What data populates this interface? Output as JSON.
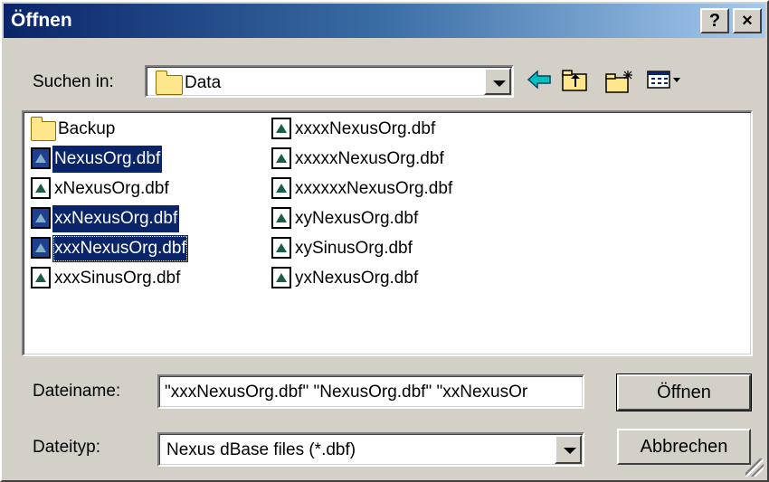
{
  "window": {
    "title": "Öffnen",
    "help_button": "?",
    "close_button": "×"
  },
  "lookin": {
    "label": "Suchen in:",
    "value": "Data",
    "icon": "folder-icon"
  },
  "toolbar": {
    "back_icon": "arrow-left-icon",
    "up_icon": "folder-up-icon",
    "new_folder_icon": "new-folder-icon",
    "view_menu_icon": "view-menu-icon"
  },
  "files": {
    "col1": [
      {
        "name": "Backup",
        "type": "folder",
        "selected": false
      },
      {
        "name": "NexusOrg.dbf",
        "type": "file",
        "selected": true
      },
      {
        "name": "xNexusOrg.dbf",
        "type": "file",
        "selected": false
      },
      {
        "name": "xxNexusOrg.dbf",
        "type": "file",
        "selected": true
      },
      {
        "name": "xxxNexusOrg.dbf",
        "type": "file",
        "selected": true,
        "focused": true
      },
      {
        "name": "xxxSinusOrg.dbf",
        "type": "file",
        "selected": false
      }
    ],
    "col2": [
      {
        "name": "xxxxNexusOrg.dbf",
        "type": "file",
        "selected": false
      },
      {
        "name": "xxxxxNexusOrg.dbf",
        "type": "file",
        "selected": false
      },
      {
        "name": "xxxxxxNexusOrg.dbf",
        "type": "file",
        "selected": false
      },
      {
        "name": "xyNexusOrg.dbf",
        "type": "file",
        "selected": false
      },
      {
        "name": "xySinusOrg.dbf",
        "type": "file",
        "selected": false
      },
      {
        "name": "yxNexusOrg.dbf",
        "type": "file",
        "selected": false
      }
    ]
  },
  "filename": {
    "label": "Dateiname:",
    "value": "\"xxxNexusOrg.dbf\" \"NexusOrg.dbf\" \"xxNexusOr"
  },
  "filetype": {
    "label": "Dateityp:",
    "value": "Nexus dBase files (*.dbf)"
  },
  "buttons": {
    "open": "Öffnen",
    "cancel": "Abbrechen"
  },
  "colors": {
    "face": "#d4d0c8",
    "selection": "#0a246a",
    "title_start": "#0a246a",
    "title_end": "#a6caf0"
  }
}
